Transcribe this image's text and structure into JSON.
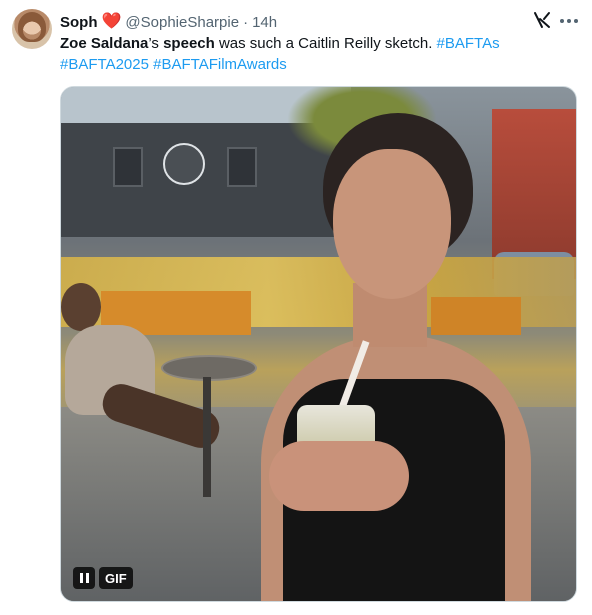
{
  "tweet": {
    "author_name": "Soph",
    "author_emoji": "❤️",
    "handle": "@SophieSharpie",
    "separator": "·",
    "time": "14h",
    "text_parts": {
      "bold1": "Zoe Saldana",
      "plain1": "’s ",
      "bold2": "speech",
      "plain2": " was such a Caitlin Reilly sketch. ",
      "hashtag1": "#BAFTAs",
      "hashtag2": "#BAFTA2025",
      "hashtag3": "#BAFTAFilmAwards"
    }
  },
  "media": {
    "badge_label": "GIF"
  },
  "icons": {
    "grok": "grok-icon",
    "more": "more-icon",
    "pause": "pause-icon"
  },
  "colors": {
    "link": "#1d9bf0",
    "heart": "#e0245e",
    "secondary_text": "#536471"
  }
}
